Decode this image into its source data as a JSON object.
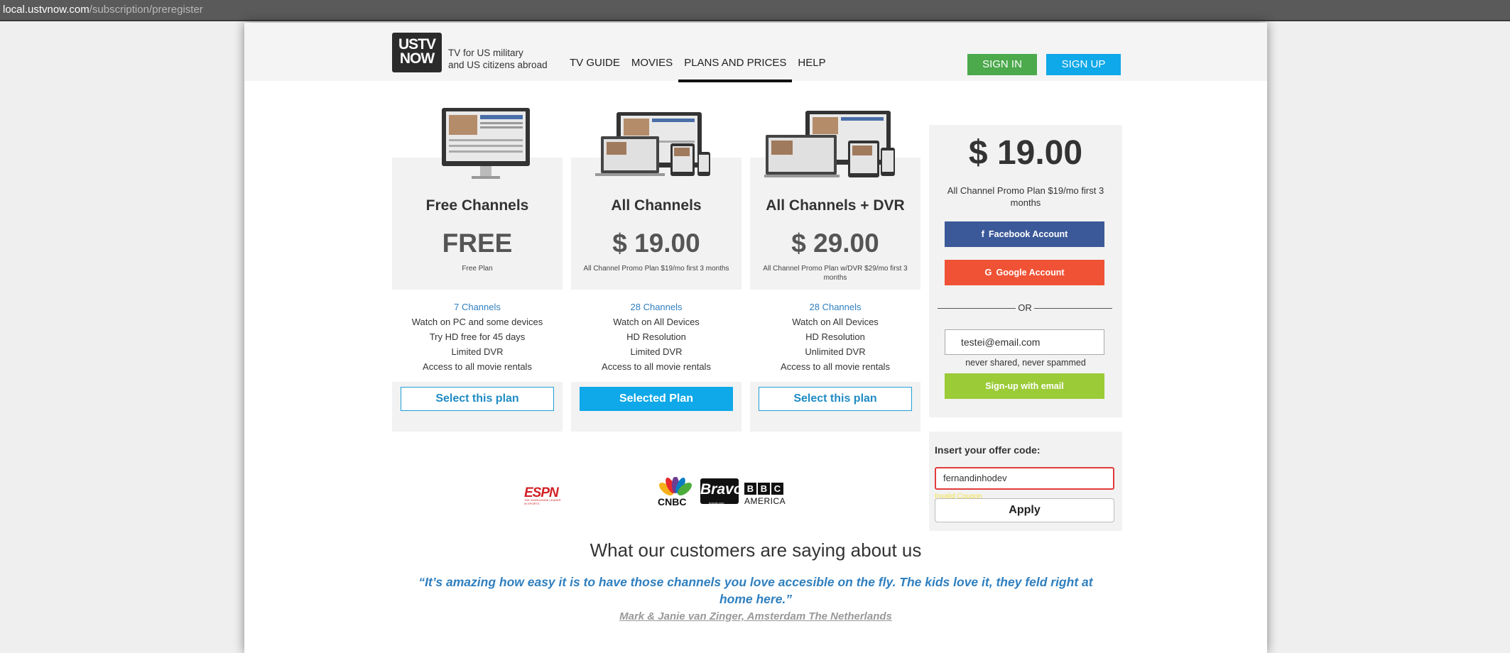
{
  "browser": {
    "url_host": "local.ustvnow.com",
    "url_path": "/subscription/preregister"
  },
  "header": {
    "logo_line1": "USTV",
    "logo_line2": "NOW",
    "tagline_line1": "TV for US military",
    "tagline_line2": "and US citizens abroad",
    "nav": [
      "TV GUIDE",
      "MOVIES",
      "PLANS AND PRICES",
      "HELP"
    ],
    "active_nav": "PLANS AND PRICES",
    "sign_in": "SIGN IN",
    "sign_up": "SIGN UP"
  },
  "plans": [
    {
      "name": "Free Channels",
      "price": "FREE",
      "desc": "Free Plan",
      "features": [
        "7 Channels",
        "Watch on PC and some devices",
        "Try HD free for 45 days",
        "Limited DVR",
        "Access to all movie rentals"
      ],
      "button": "Select this plan",
      "selected": false
    },
    {
      "name": "All Channels",
      "price": "$ 19.00",
      "desc": "All Channel Promo Plan $19/mo first 3 months",
      "features": [
        "28 Channels",
        "Watch on All Devices",
        "HD Resolution",
        "Limited DVR",
        "Access to all movie rentals"
      ],
      "button": "Selected Plan",
      "selected": true
    },
    {
      "name": "All Channels + DVR",
      "price": "$ 29.00",
      "desc": "All Channel Promo Plan w/DVR $29/mo first 3 months",
      "features": [
        "28 Channels",
        "Watch on All Devices",
        "HD Resolution",
        "Unlimited DVR",
        "Access to all movie rentals"
      ],
      "button": "Select this plan",
      "selected": false
    }
  ],
  "signup": {
    "price": "$ 19.00",
    "desc": "All Channel Promo Plan $19/mo first 3 months",
    "facebook": "Facebook Account",
    "google": "Google Account",
    "or": "OR",
    "email_value": "testei@email.com",
    "never_shared": "never shared, never spammed",
    "email_button": "Sign-up with email"
  },
  "offer": {
    "label": "Insert your offer code:",
    "code_value": "fernandinhodev",
    "error": "Invalid Coupon",
    "apply": "Apply"
  },
  "channels": {
    "espn": "ESPN",
    "espn_sub": "THE WORLDWIDE LEADER IN SPORTS",
    "cnbc": "CNBC",
    "bravo": "Bravo",
    "bravo_sub": "bravotv.com",
    "bbc": [
      "B",
      "B",
      "C"
    ],
    "bbc_america": "AMERICA"
  },
  "testimonial": {
    "heading": "What our customers are saying about us",
    "quote": "“It’s amazing how easy it is to have those channels you love accesible on the fly. The kids love it, they feld right at home here.”",
    "author": "Mark & Janie van Zinger, Amsterdam The Netherlands"
  },
  "colors": {
    "sign_in": "#4ca94c",
    "sign_up": "#0fa8e8",
    "facebook": "#3b5998",
    "google": "#f05235",
    "email_signup": "#9bcb37",
    "link_blue": "#2f7fbf"
  }
}
